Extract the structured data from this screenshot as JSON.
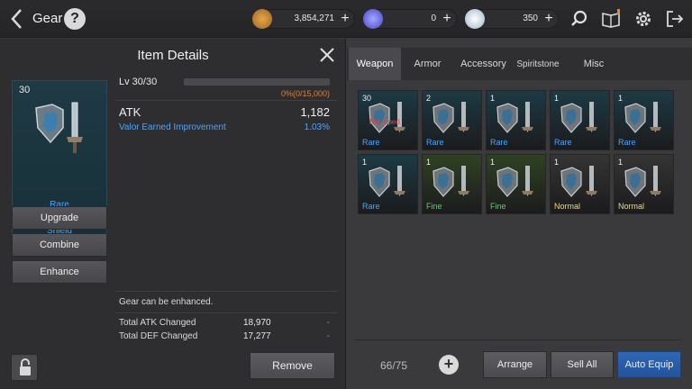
{
  "header": {
    "title": "Gear",
    "help_label": "?",
    "currencies": [
      {
        "name": "gold",
        "value": "3,854,271",
        "color": "#c98a2f"
      },
      {
        "name": "gem",
        "value": "0",
        "color": "#6a6cf0"
      },
      {
        "name": "crystal",
        "value": "350",
        "color": "#cfe2ee"
      }
    ],
    "plus_label": "+"
  },
  "details": {
    "title": "Item Details",
    "item": {
      "level": "30",
      "rarity": "Rare",
      "name": "Heavenly Sword and Shield"
    },
    "actions": {
      "upgrade": "Upgrade",
      "combine": "Combine",
      "enhance": "Enhance",
      "remove": "Remove"
    },
    "level_text": "Lv 30/30",
    "xp_text": "0%(0/15,000)",
    "xp_fraction": 0,
    "atk_label": "ATK",
    "atk_value": "1,182",
    "valor_label": "Valor Earned Improvement",
    "valor_value": "1.03%",
    "note": "Gear can be enhanced.",
    "totals": [
      {
        "label": "Total ATK Changed",
        "value": "18,970",
        "change": "-"
      },
      {
        "label": "Total DEF Changed",
        "value": "17,277",
        "change": "-"
      }
    ]
  },
  "inventory": {
    "tabs": [
      {
        "label": "Weapon",
        "active": true
      },
      {
        "label": "Armor",
        "active": false
      },
      {
        "label": "Accessory",
        "active": false
      },
      {
        "label": "Spiritstone",
        "active": false
      },
      {
        "label": "Misc",
        "active": false
      }
    ],
    "items": [
      {
        "level": "30",
        "grade": "Rare",
        "equipped": "Equipped"
      },
      {
        "level": "2",
        "grade": "Rare",
        "equipped": ""
      },
      {
        "level": "1",
        "grade": "Rare",
        "equipped": ""
      },
      {
        "level": "1",
        "grade": "Rare",
        "equipped": ""
      },
      {
        "level": "1",
        "grade": "Rare",
        "equipped": ""
      },
      {
        "level": "1",
        "grade": "Rare",
        "equipped": ""
      },
      {
        "level": "1",
        "grade": "Fine",
        "equipped": ""
      },
      {
        "level": "1",
        "grade": "Fine",
        "equipped": ""
      },
      {
        "level": "1",
        "grade": "Normal",
        "equipped": ""
      },
      {
        "level": "1",
        "grade": "Normal",
        "equipped": ""
      }
    ],
    "grade_colors": {
      "Rare": "#4aa4ff",
      "Fine": "#5fd35f",
      "Normal": "#f0d98c"
    },
    "grade_backgrounds": {
      "Rare": "#1d3a44",
      "Fine": "#2f4223",
      "Normal": "#343434"
    },
    "count": "66/75",
    "add_label": "+",
    "arrange": "Arrange",
    "sell_all": "Sell All",
    "auto_equip": "Auto Equip"
  }
}
